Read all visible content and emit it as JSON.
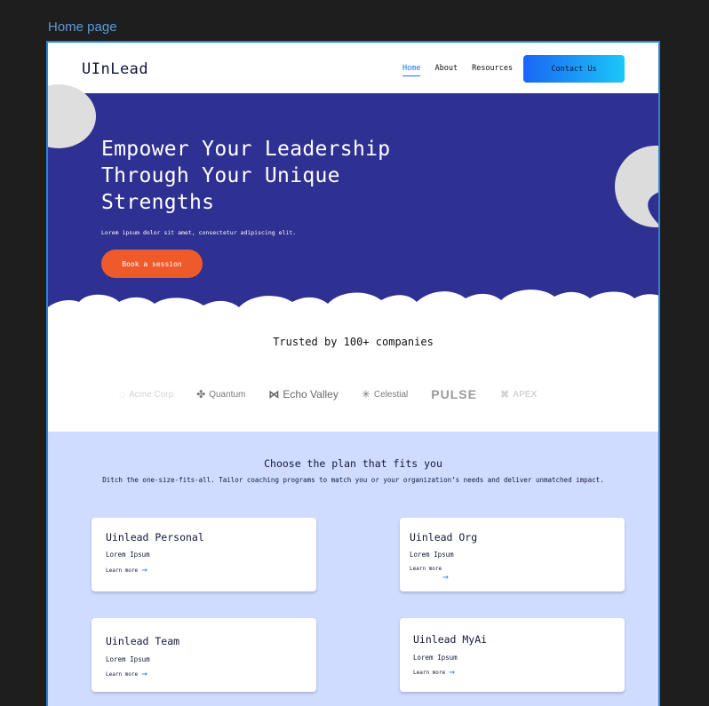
{
  "frame": {
    "label": "Home page"
  },
  "nav": {
    "logo": "UInLead",
    "links": [
      "Home",
      "About",
      "Resources"
    ],
    "cta": "Contact Us"
  },
  "hero": {
    "title_lines": [
      "Empower Your Leadership",
      "Through Your Unique",
      "Strengths"
    ],
    "subtitle": "Lorem ipsum dolor sit amet, consectetur adipiscing elit.",
    "button": "Book a session",
    "colors": {
      "background": "#2e3192",
      "button": "#ef5a2a"
    }
  },
  "trusted": {
    "heading": "Trusted by 100+ companies",
    "logos": [
      "Acme Corp",
      "Quantum",
      "Echo Valley",
      "Celestial",
      "PULSE",
      "APEX"
    ]
  },
  "plans": {
    "title": "Choose the plan that fits you",
    "subtitle": "Ditch the one-size-fits-all. Tailor coaching programs to match you or your organization’s needs and deliver unmatched impact.",
    "background": "#cfdbff",
    "cards": [
      {
        "title": "Uinlead Personal",
        "text": "Lorem Ipsum",
        "link": "Learn more"
      },
      {
        "title": "Uinlead Org",
        "text": "Lorem Ipsum",
        "link": "Learn more"
      },
      {
        "title": "Uinlead Team",
        "text": "Lorem Ipsum",
        "link": "Learn more"
      },
      {
        "title": "Uinlead MyAi",
        "text": "Lorem Ipsum",
        "link": "Learn more"
      }
    ]
  }
}
